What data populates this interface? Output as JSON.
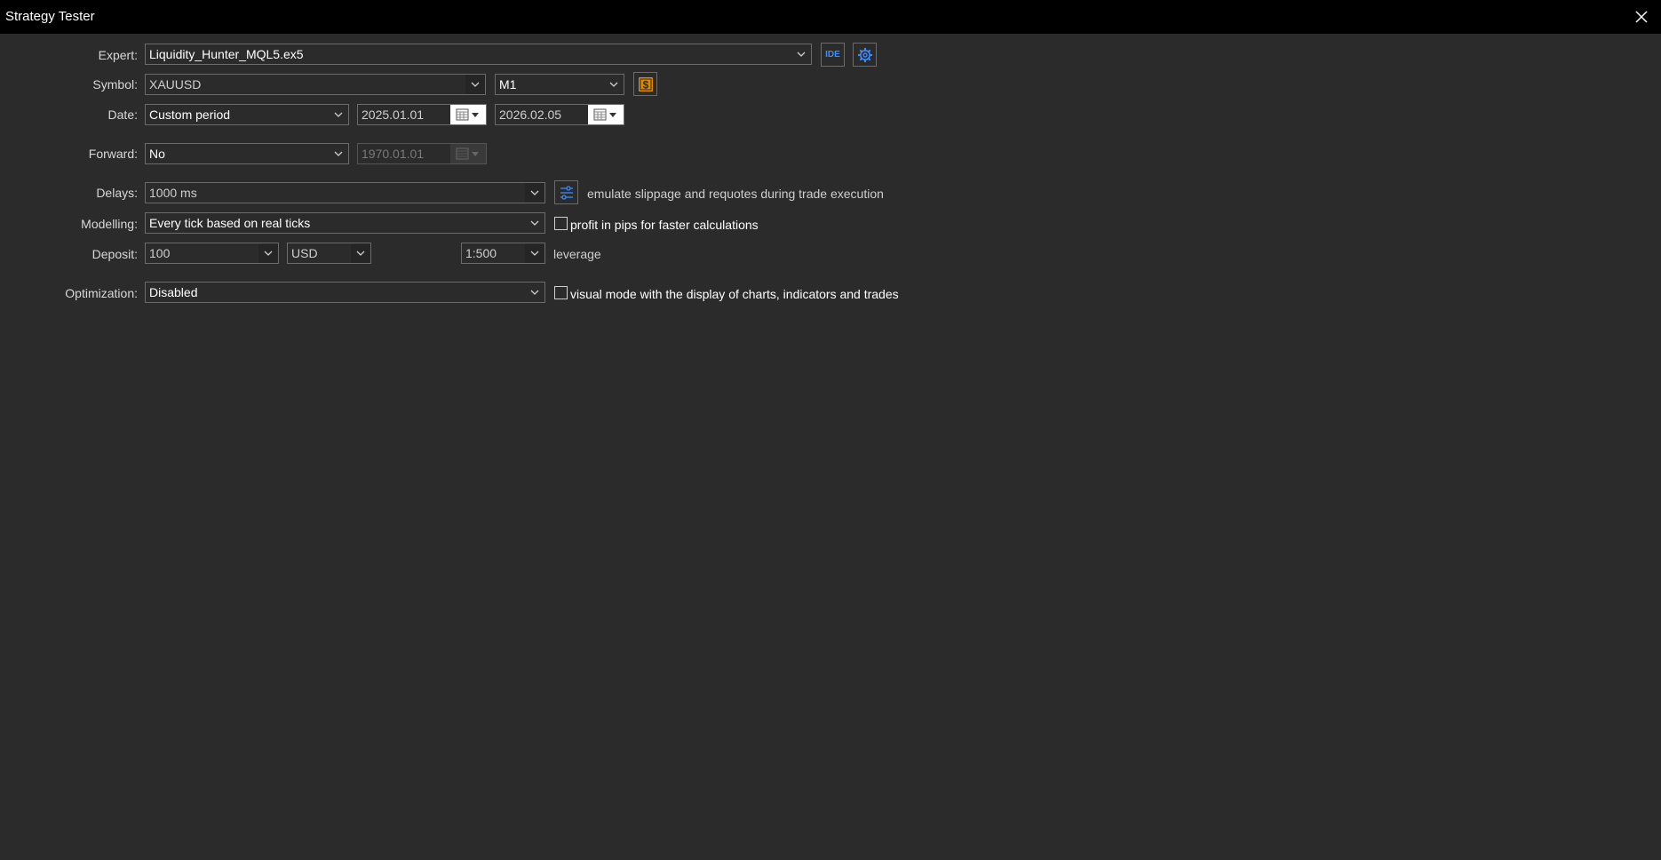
{
  "window": {
    "title": "Strategy Tester",
    "close_icon": "close-icon"
  },
  "expert": {
    "label": "Expert:",
    "value": "Liquidity_Hunter_MQL5.ex5",
    "ide_label": "IDE",
    "settings_icon": "gear-icon"
  },
  "symbol": {
    "label": "Symbol:",
    "value": "XAUUSD",
    "timeframe": "M1",
    "symbol_icon": "dollar-icon"
  },
  "date": {
    "label": "Date:",
    "period": "Custom period",
    "from": "2025.01.01",
    "to": "2026.02.05",
    "calendar_icon": "calendar-icon"
  },
  "forward": {
    "label": "Forward:",
    "value": "No",
    "date": "1970.01.01"
  },
  "delays": {
    "label": "Delays:",
    "value": "1000 ms",
    "settings_icon": "sliders-icon",
    "description": "emulate slippage and requotes during trade execution"
  },
  "modelling": {
    "label": "Modelling:",
    "value": "Every tick based on real ticks",
    "checkbox_label": "profit in pips for faster calculations",
    "checked": false
  },
  "deposit": {
    "label": "Deposit:",
    "amount": "100",
    "currency": "USD",
    "leverage_value": "1:500",
    "leverage_label": "leverage"
  },
  "optimization": {
    "label": "Optimization:",
    "value": "Disabled",
    "checkbox_label": "visual mode with the display of charts, indicators and trades",
    "checked": false
  },
  "colors": {
    "titlebar": "#000000",
    "background": "#2b2b2b",
    "accent_blue": "#3d8bff",
    "accent_orange": "#e08a00"
  }
}
